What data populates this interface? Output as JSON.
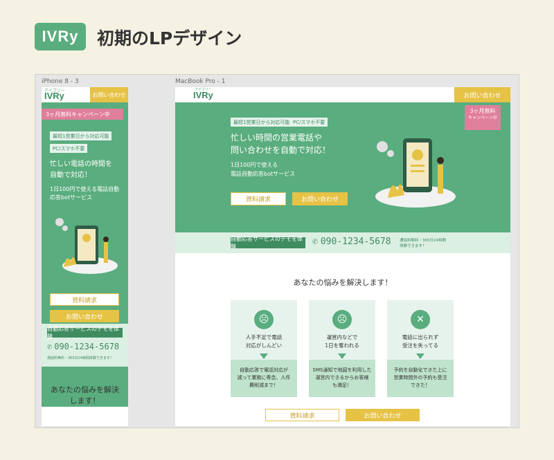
{
  "header": {
    "logo_text": "IVRy",
    "title": "初期のLPデザイン"
  },
  "frames": {
    "mobile_label": "iPhone 8 - 3",
    "desktop_label": "MacBook Pro - 1"
  },
  "mobile": {
    "logo": "IVRy",
    "logo_sub": "アイブリー",
    "contact_button": "お問い合わせ",
    "campaign": "3ヶ月無料キャンペーン中",
    "tags": [
      "最短1営業日から対応可能",
      "PC/スマホ不要"
    ],
    "headline": [
      "忙しい電話の時間を",
      "自動で対応！"
    ],
    "sub": [
      "1日100円で使える電話自動",
      "応答botサービス"
    ],
    "btn_docs": "資料請求",
    "btn_contact": "お問い合わせ",
    "demo_label": "自動応答サービスのデモを体験",
    "phone_number": "090-1234-5678",
    "demo_note": "通話料無料・365日24時間体験できます！",
    "problems_title": [
      "あなたの悩みを解決",
      "します！"
    ]
  },
  "desktop": {
    "logo": "IVRy",
    "logo_sub": "アイブリー",
    "contact_button": "お問い合わせ",
    "campaign": [
      "3ヶ月無料",
      "キャンペーン中"
    ],
    "tags": [
      "最短1営業日から対応可能",
      "PC/スマホ不要"
    ],
    "headline": [
      "忙しい時間の営業電話や",
      "問い合わせを自動で対応！"
    ],
    "sub": [
      "1日100円で使える",
      "電話自動応答botサービス"
    ],
    "btn_docs": "資料請求",
    "btn_contact": "お問い合わせ",
    "demo_label": "自動応答サービスのデモを体験",
    "phone_number": "090-1234-5678",
    "demo_note": [
      "通話料無料・365日24時間",
      "体験できます！"
    ],
    "problems_title": "あなたの悩みを解決します！",
    "cards": [
      {
        "top": [
          "人手不足で電話",
          "対応がしんどい"
        ],
        "bottom": [
          "自動応答で電話対応が",
          "減って業務に専念、人件",
          "費削減まで！"
        ]
      },
      {
        "top": [
          "運営内などで",
          "1日を奪われる"
        ],
        "bottom": [
          "SMS通知で地図を利用した",
          "運営内できるからお客様",
          "も満足！"
        ]
      },
      {
        "top": [
          "電話に出られず",
          "受注を失ってる"
        ],
        "bottom": [
          "予約を自動化できた上に",
          "営業時間外の予約も受注",
          "できた！"
        ]
      }
    ],
    "bottom_btn_docs": "資料請求",
    "bottom_btn_contact": "お問い合わせ"
  },
  "colors": {
    "brand_green": "#5aad7e",
    "accent_yellow": "#e6c245",
    "campaign_pink": "#e07f9b",
    "mint": "#dcefe3",
    "background": "#f6f2e3"
  }
}
